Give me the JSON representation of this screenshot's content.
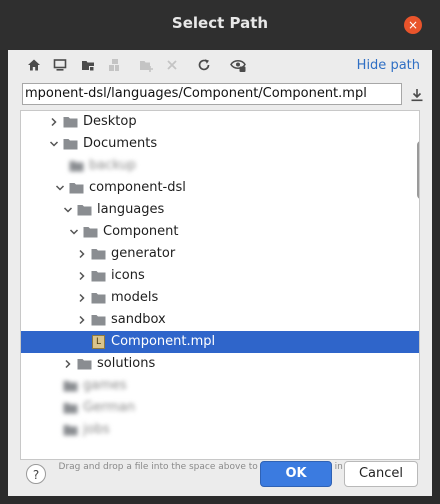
{
  "window": {
    "title": "Select Path",
    "close_label": "×"
  },
  "toolbar": {
    "icons": [
      "home-icon",
      "desktop-icon",
      "project-icon",
      "module-icon",
      "new-folder-icon",
      "delete-icon",
      "refresh-icon",
      "show-hidden-icon"
    ],
    "hide_path_label": "Hide path"
  },
  "path": {
    "value": "mponent-dsl/languages/Component/Component.mpl"
  },
  "tree": {
    "rows": [
      {
        "label": "Desktop"
      },
      {
        "label": "Documents"
      },
      {
        "label": "backup"
      },
      {
        "label": "component-dsl"
      },
      {
        "label": "languages"
      },
      {
        "label": "Component"
      },
      {
        "label": "generator"
      },
      {
        "label": "icons"
      },
      {
        "label": "models"
      },
      {
        "label": "sandbox"
      },
      {
        "label": "Component.mpl"
      },
      {
        "label": "solutions"
      },
      {
        "label": "games"
      },
      {
        "label": "German"
      },
      {
        "label": "jobs"
      }
    ]
  },
  "hint": "Drag and drop a file into the space above to quickly locate it in the tree",
  "footer": {
    "help_label": "?",
    "ok_label": "OK",
    "cancel_label": "Cancel"
  }
}
